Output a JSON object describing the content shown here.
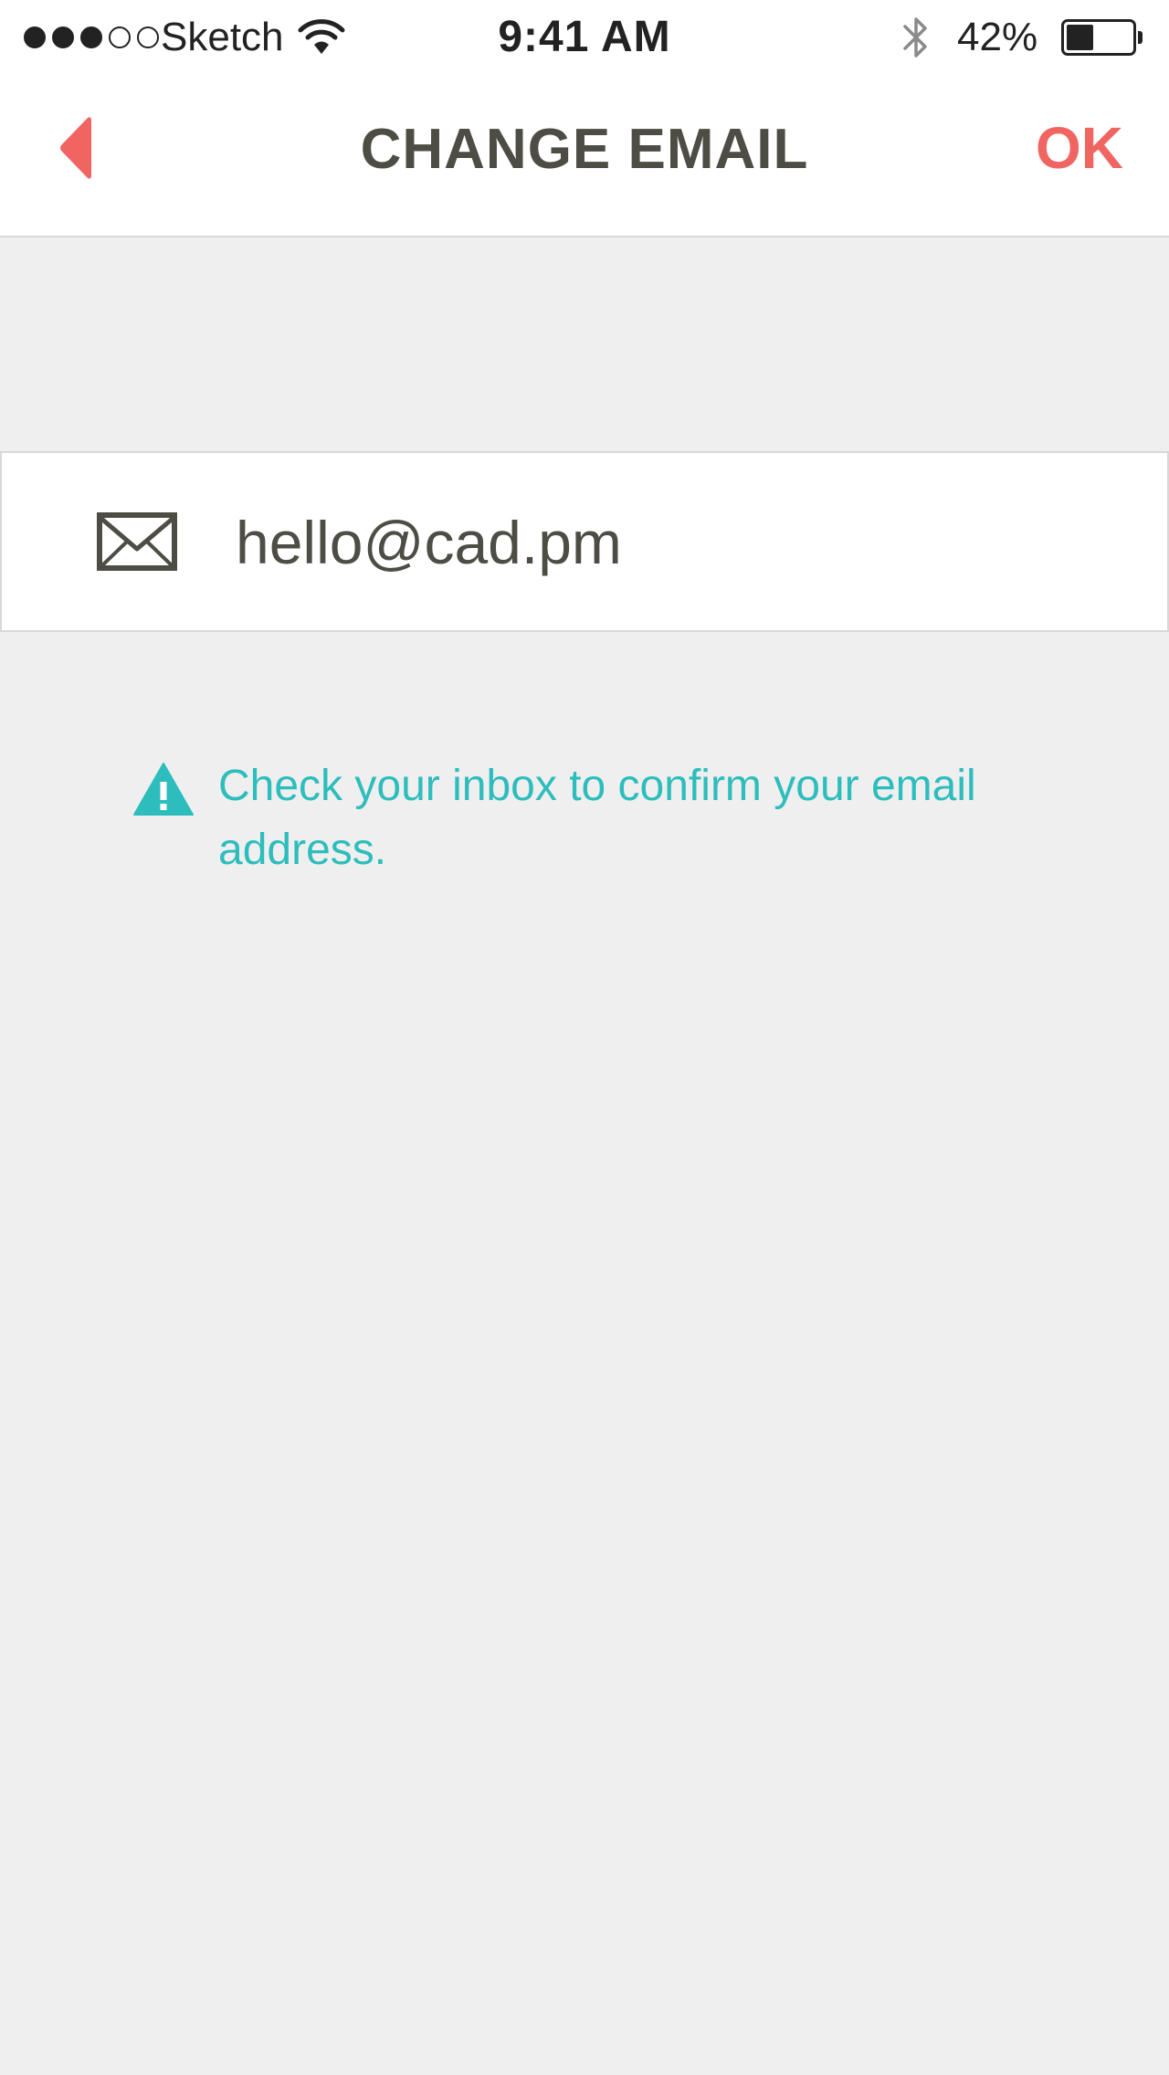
{
  "status_bar": {
    "signal": {
      "filled": 3,
      "total": 5
    },
    "carrier": "Sketch",
    "time": "9:41 AM",
    "battery_percent_label": "42%",
    "battery_level": 0.42,
    "icons": [
      "wifi-icon",
      "bluetooth-icon",
      "battery-icon"
    ]
  },
  "nav": {
    "title": "CHANGE EMAIL",
    "back_icon": "chevron-left-icon",
    "ok_label": "OK"
  },
  "email_field": {
    "icon": "envelope-icon",
    "value": "hello@cad.pm",
    "placeholder": ""
  },
  "notice": {
    "icon": "warning-icon",
    "text": "Check your inbox to confirm your email address."
  },
  "colors": {
    "accent": "#f06562",
    "info": "#2ebdbd",
    "text_dark": "#4d4d45",
    "background": "#efefef"
  }
}
